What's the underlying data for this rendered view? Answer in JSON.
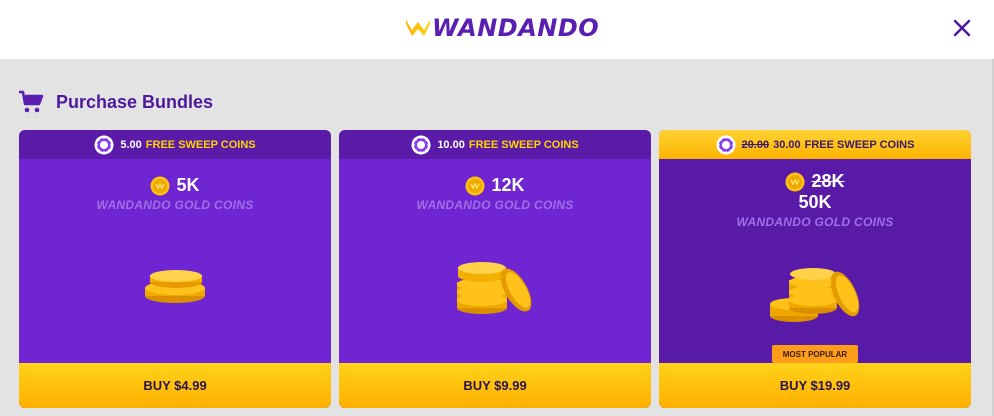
{
  "header": {
    "logo_text": "WANDANDO",
    "close_icon": "close-icon"
  },
  "section": {
    "title": "Purchase Bundles",
    "icon": "cart-icon"
  },
  "bundles": [
    {
      "sweep_amount": "5.00",
      "sweep_old": "",
      "sweep_label": "FREE SWEEP COINS",
      "gold_amount": "5K",
      "gold_old": "",
      "gold_label": "WANDANDO GOLD COINS",
      "buy_label": "BUY $4.99"
    },
    {
      "sweep_amount": "10.00",
      "sweep_old": "",
      "sweep_label": "FREE SWEEP COINS",
      "gold_amount": "12K",
      "gold_old": "",
      "gold_label": "WANDANDO GOLD COINS",
      "buy_label": "BUY $9.99"
    },
    {
      "sweep_amount": "30.00",
      "sweep_old": "20.00",
      "sweep_label": "FREE SWEEP COINS",
      "gold_amount": "50K",
      "gold_old": "28K",
      "gold_label": "WANDANDO GOLD COINS",
      "badge": "MOST POPULAR",
      "buy_label": "BUY $19.99"
    }
  ],
  "colors": {
    "brand_purple": "#5a1fb0",
    "card_purple": "#6f25d1",
    "card_purple_featured": "#5a1aa8",
    "gold": "#ffc20e",
    "badge_orange": "#ff9d1a"
  }
}
